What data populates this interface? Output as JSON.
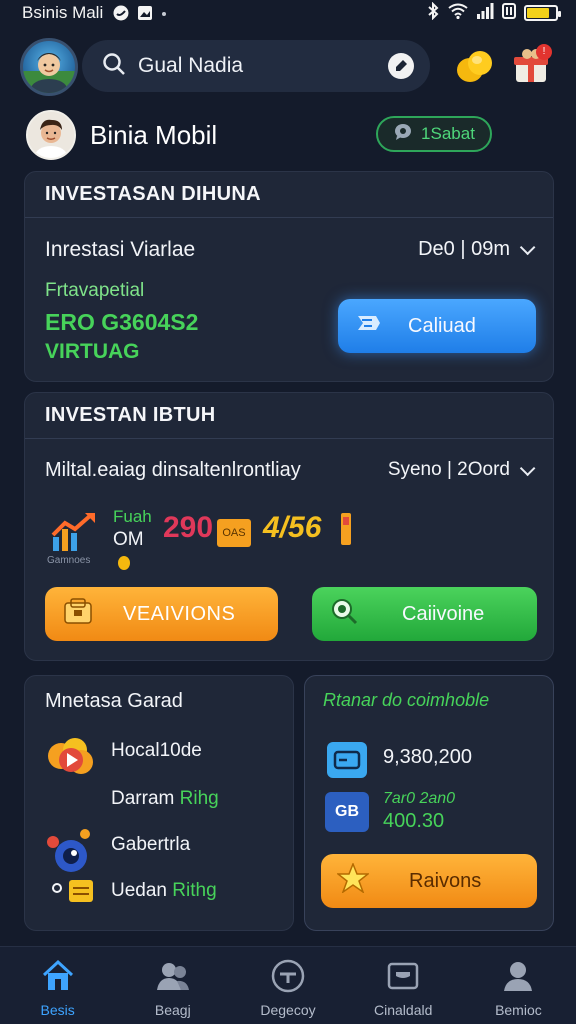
{
  "status_bar": {
    "carrier": "Bsinis Mali"
  },
  "header": {
    "search_text": "Gual Nadia"
  },
  "profile": {
    "name": "Binia Mobil",
    "badge": "1Sabat"
  },
  "section1": {
    "title": "INVESTASAN DIHUNA",
    "row_title": "Inrestasi Viarlae",
    "row_value": "De0 | 09m",
    "label": "Frtavapetial",
    "amount": "ERO G3604S2",
    "sub_amount": "VIRTUAG",
    "button_label": "Caliuad"
  },
  "section2": {
    "title": "INVESTAN IBTUH",
    "row_title": "Miltal.eaiag dinsaltenlrontliay",
    "row_value": "Syeno | 2Oord",
    "stat_label_1": "Fuah",
    "stat_label_2": "OM",
    "stat_value_1": "290",
    "stat_tag_1": "OAS",
    "stat_value_2": "4/56",
    "stat_caption": "Gamnoes",
    "button_left_label": "VEAIVIONS",
    "button_right_label": "Caiivoine"
  },
  "section3_left": {
    "title": "Mnetasa Garad",
    "item1": "Hocal10de",
    "item1_sub_prefix": "Darram",
    "item1_sub_suffix": "Rihg",
    "item2": "Gabertrla",
    "item2_sub_prefix": "Uedan",
    "item2_sub_suffix": "Rithg"
  },
  "section3_right": {
    "title": "Rtanar do coimhoble",
    "value1": "9,380,200",
    "icon2_label": "GB",
    "value2_top": "7ar0 2an0",
    "value2_bottom": "400.30",
    "button_label": "Raivons"
  },
  "bottom_nav": {
    "items": [
      {
        "label": "Besis"
      },
      {
        "label": "Beagj"
      },
      {
        "label": "Degecoy"
      },
      {
        "label": "Cinaldald"
      },
      {
        "label": "Bemioc"
      }
    ]
  },
  "colors": {
    "accent_blue": "#3ea4ff",
    "accent_green": "#4ed67a",
    "accent_orange": "#f5a020",
    "background": "#141b2b",
    "card": "#1f2738"
  },
  "icons": [
    "twitter-icon",
    "image-icon",
    "bluetooth-icon",
    "wifi-icon",
    "signal-icon",
    "battery-icon",
    "search-icon",
    "mic-icon",
    "coin-icon",
    "gift-icon",
    "chart-icon",
    "play-icon",
    "chat-icon",
    "home-icon",
    "users-icon",
    "gauge-icon",
    "wallet-icon",
    "person-icon",
    "star-icon"
  ]
}
